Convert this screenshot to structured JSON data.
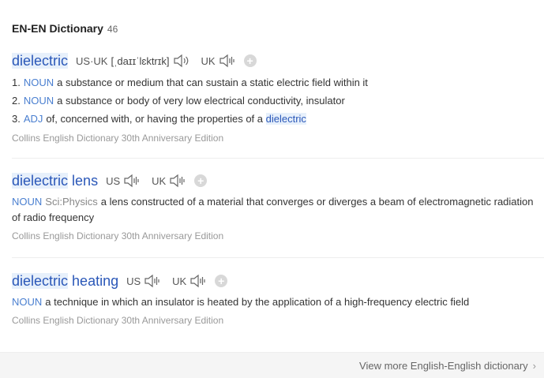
{
  "header": {
    "title": "EN-EN Dictionary",
    "count": "46"
  },
  "entries": [
    {
      "word_parts": [
        "dielectric",
        ""
      ],
      "pron": {
        "us_uk_label": "US·UK",
        "ipa": "[ˌdaɪɪˈlɛktrɪk]",
        "uk_label": "UK"
      },
      "senses": [
        {
          "num": "1.",
          "pos": "NOUN",
          "text": "a substance or medium that can sustain a static electric field within it"
        },
        {
          "num": "2.",
          "pos": "NOUN",
          "text": "a substance or body of very low electrical conductivity, insulator"
        },
        {
          "num": "3.",
          "pos": "ADJ",
          "text": "of, concerned with, or having the properties of a",
          "highlight": "dielectric"
        }
      ],
      "source": "Collins English Dictionary 30th Anniversary Edition"
    },
    {
      "word_parts": [
        "dielectric",
        "lens"
      ],
      "pron": {
        "us_label": "US",
        "uk_label": "UK"
      },
      "def": {
        "pos": "NOUN",
        "domain": "Sci:Physics",
        "text": "a lens constructed of a material that converges or diverges a beam of electromagnetic radiation of radio frequency"
      },
      "source": "Collins English Dictionary 30th Anniversary Edition"
    },
    {
      "word_parts": [
        "dielectric",
        "heating"
      ],
      "pron": {
        "us_label": "US",
        "uk_label": "UK"
      },
      "def": {
        "pos": "NOUN",
        "text": "a technique in which an insulator is heated by the application of a high-frequency electric field"
      },
      "source": "Collins English Dictionary 30th Anniversary Edition"
    }
  ],
  "footer": {
    "more_label": "View more English-English dictionary",
    "chevron": "›"
  },
  "icons": {
    "speaker": "speaker-icon",
    "add": "add-icon"
  },
  "colors": {
    "word": "#2a57b8",
    "pos": "#4a7fd0",
    "highlight_bg": "#e7f0fb",
    "source": "#999999"
  }
}
